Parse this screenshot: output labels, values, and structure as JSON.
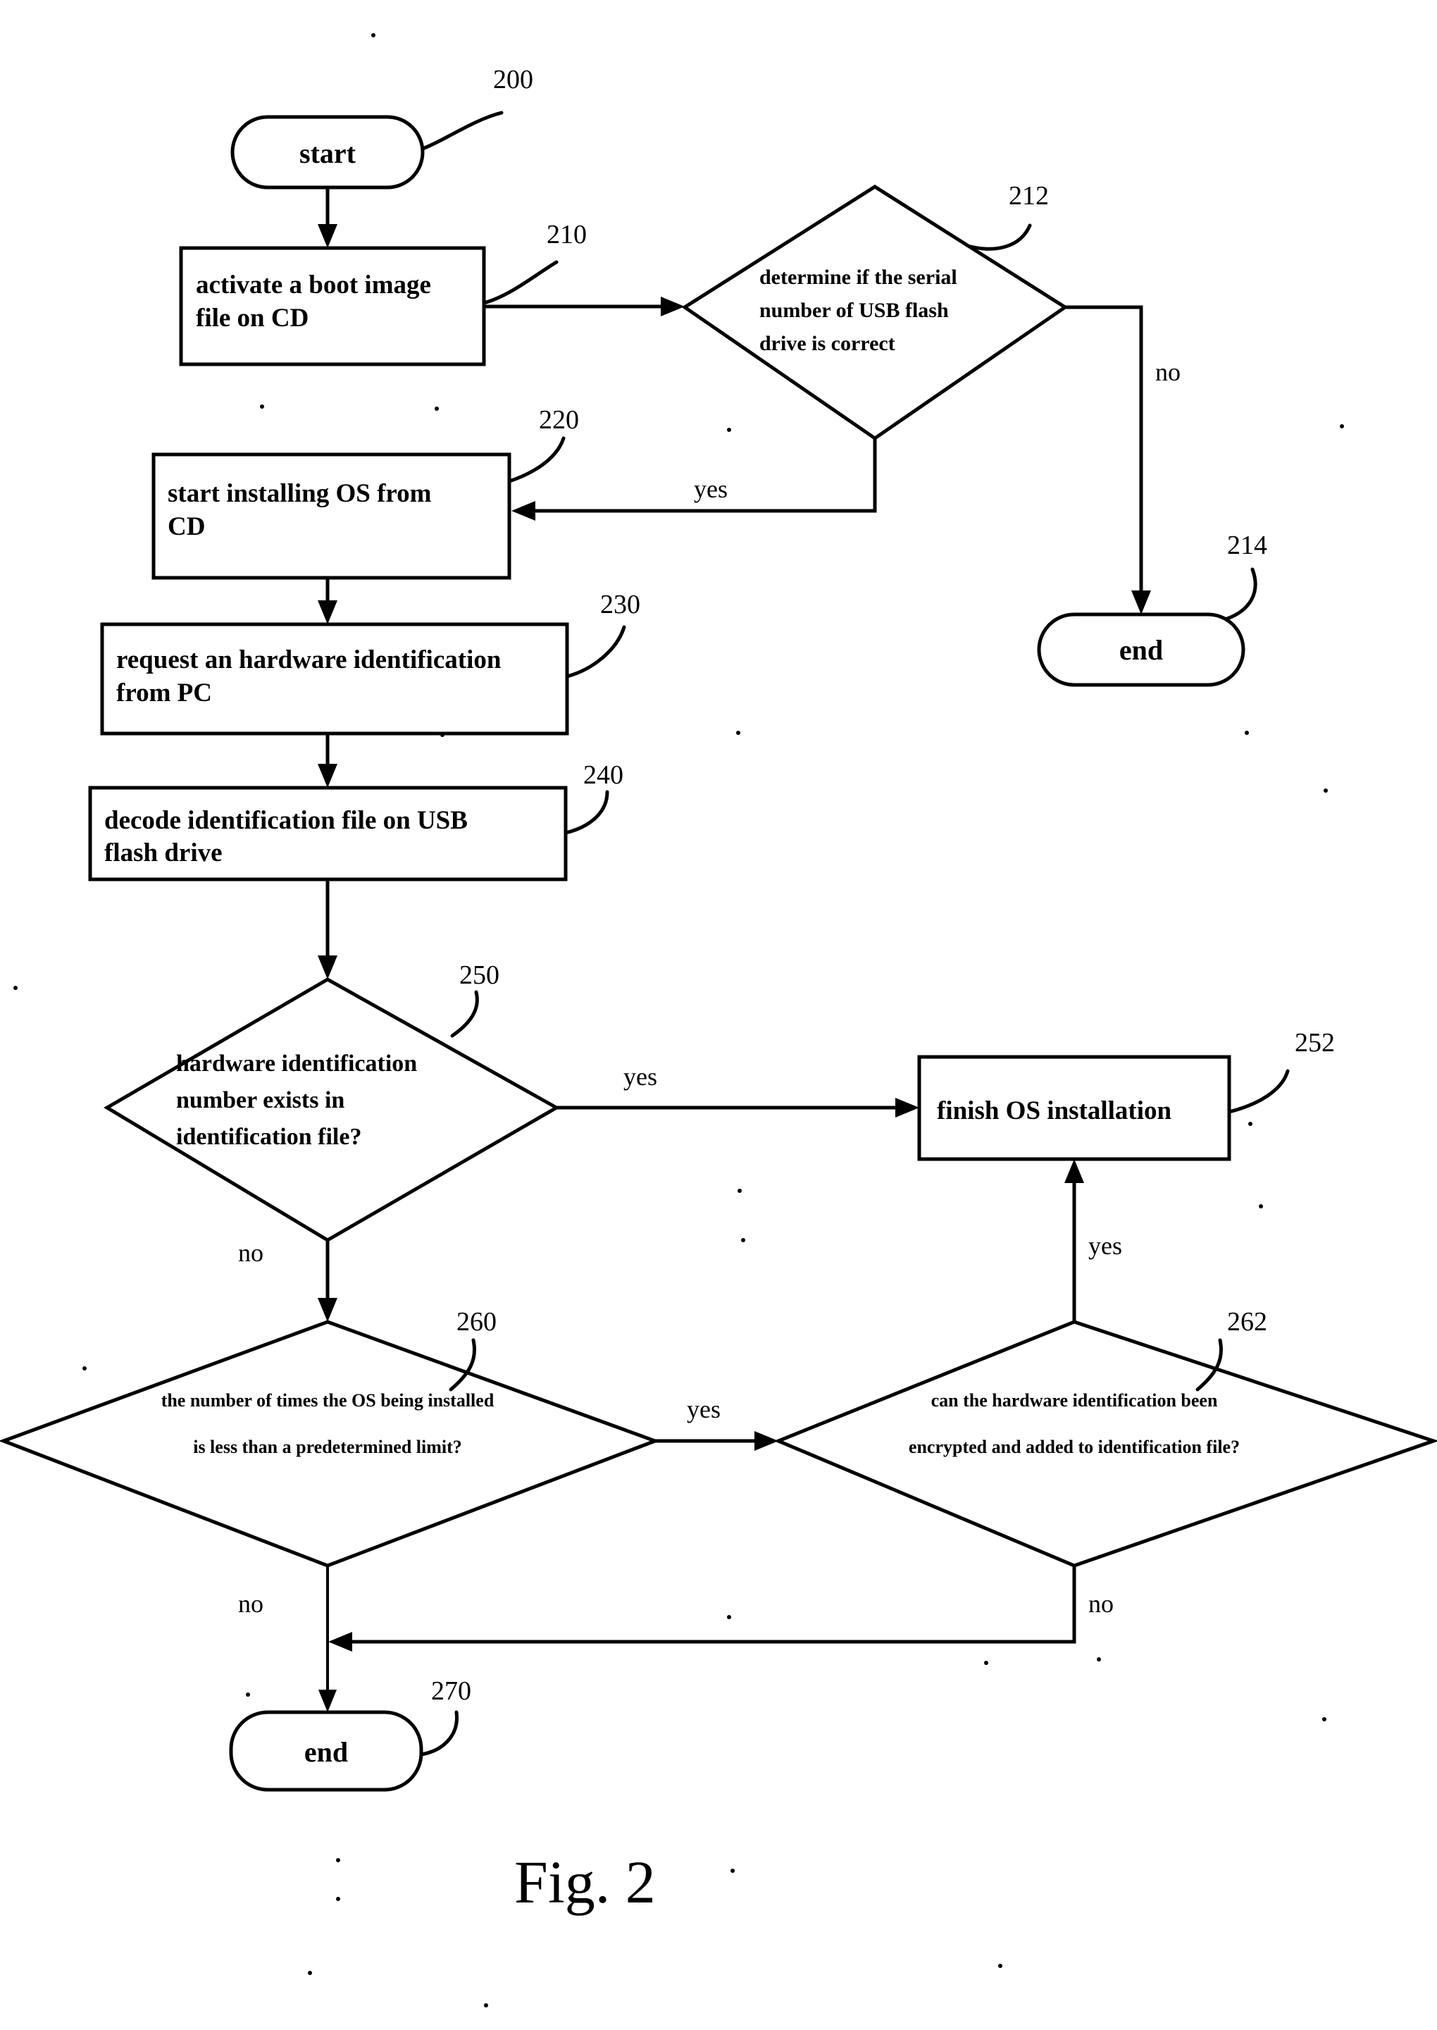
{
  "figure": {
    "caption": "Fig. 2"
  },
  "nodes": {
    "start": {
      "label": "start",
      "ref": "200",
      "type": "terminator"
    },
    "activate_boot": {
      "label_lines": [
        "activate a boot image",
        "file on CD"
      ],
      "ref": "210",
      "type": "process"
    },
    "serial_check": {
      "label_lines": [
        "determine if the serial",
        "number of USB flash",
        "drive is correct"
      ],
      "ref": "212",
      "type": "decision"
    },
    "end_top": {
      "label": "end",
      "ref": "214",
      "type": "terminator"
    },
    "install_os": {
      "label_lines": [
        "start installing OS from",
        "CD"
      ],
      "ref": "220",
      "type": "process"
    },
    "request_hwid": {
      "label_lines": [
        "request an hardware identification",
        "from PC"
      ],
      "ref": "230",
      "type": "process"
    },
    "decode_file": {
      "label_lines": [
        "decode identification file on USB",
        "flash drive"
      ],
      "ref": "240",
      "type": "process"
    },
    "hwid_exists": {
      "label_lines": [
        "hardware identification",
        "number exists in",
        "identification file?"
      ],
      "ref": "250",
      "type": "decision"
    },
    "finish_install": {
      "label_lines": [
        "finish OS installation"
      ],
      "ref": "252",
      "type": "process"
    },
    "under_limit": {
      "label_lines": [
        "the number of times the OS being installed",
        "is less than a predetermined limit?"
      ],
      "ref": "260",
      "type": "decision"
    },
    "can_encrypt": {
      "label_lines": [
        "can the hardware identification been",
        "encrypted and added to identification file?"
      ],
      "ref": "262",
      "type": "decision"
    },
    "end_bottom": {
      "label": "end",
      "ref": "270",
      "type": "terminator"
    }
  },
  "branch_labels": {
    "serial_no": "no",
    "serial_yes": "yes",
    "hwid_yes": "yes",
    "hwid_no": "no",
    "limit_yes": "yes",
    "limit_no": "no",
    "encrypt_yes": "yes",
    "encrypt_no": "no"
  },
  "colors": {
    "ink": "#000000",
    "paper": "#ffffff"
  }
}
